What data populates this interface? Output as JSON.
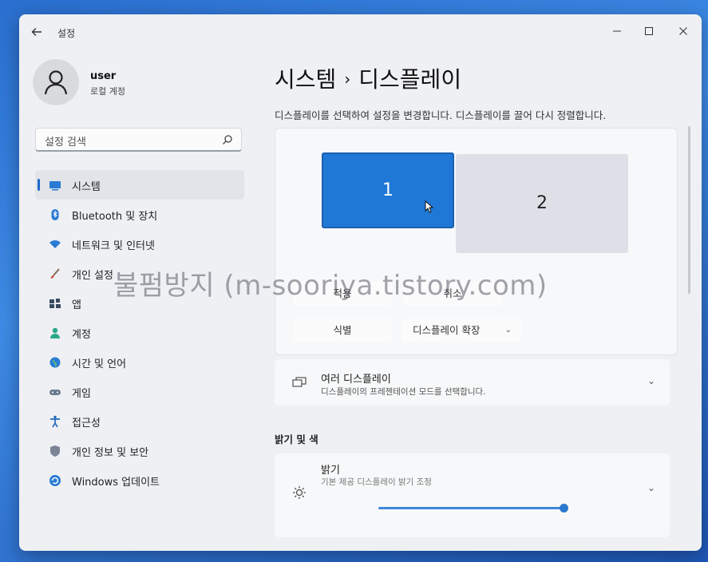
{
  "window": {
    "title": "설정",
    "controls": {
      "minimize": "—",
      "maximize": "☐",
      "close": "✕"
    }
  },
  "profile": {
    "name": "user",
    "account_type": "로컬 계정"
  },
  "search": {
    "placeholder": "설정 검색"
  },
  "sidebar": {
    "items": [
      {
        "label": "시스템",
        "icon": "monitor-icon",
        "active": true
      },
      {
        "label": "Bluetooth 및 장치",
        "icon": "bluetooth-icon",
        "active": false
      },
      {
        "label": "네트워크 및 인터넷",
        "icon": "wifi-icon",
        "active": false
      },
      {
        "label": "개인 설정",
        "icon": "brush-icon",
        "active": false
      },
      {
        "label": "앱",
        "icon": "apps-icon",
        "active": false
      },
      {
        "label": "계정",
        "icon": "person-icon",
        "active": false
      },
      {
        "label": "시간 및 언어",
        "icon": "globe-icon",
        "active": false
      },
      {
        "label": "게임",
        "icon": "gamepad-icon",
        "active": false
      },
      {
        "label": "접근성",
        "icon": "accessibility-icon",
        "active": false
      },
      {
        "label": "개인 정보 및 보안",
        "icon": "shield-icon",
        "active": false
      },
      {
        "label": "Windows 업데이트",
        "icon": "update-icon",
        "active": false
      }
    ]
  },
  "main": {
    "breadcrumb": {
      "parent": "시스템",
      "separator": "›",
      "current": "디스플레이"
    },
    "description": "디스플레이를 선택하여 설정을 변경합니다. 디스플레이를 끌어 다시 정렬합니다.",
    "displays": [
      {
        "label": "1",
        "selected": true
      },
      {
        "label": "2",
        "selected": false
      }
    ],
    "buttons": {
      "apply": "적용",
      "cancel": "취소",
      "identify": "식별"
    },
    "extend_select": {
      "value": "디스플레이 확장"
    },
    "multi_display": {
      "title": "여러 디스플레이",
      "subtitle": "디스플레이의 프레젠테이션 모드를 선택합니다."
    },
    "brightness_section": {
      "title": "밝기 및 색"
    },
    "brightness": {
      "title": "밝기",
      "subtitle": "기본 제공 디스플레이 밝기 조정",
      "level": 1.0
    }
  },
  "watermark": "불펌방지 (m-sooriya.tistory.com)",
  "colors": {
    "accent": "#1f78d6",
    "window_bg": "#eef0f3",
    "card_bg": "#f7f8f9"
  }
}
